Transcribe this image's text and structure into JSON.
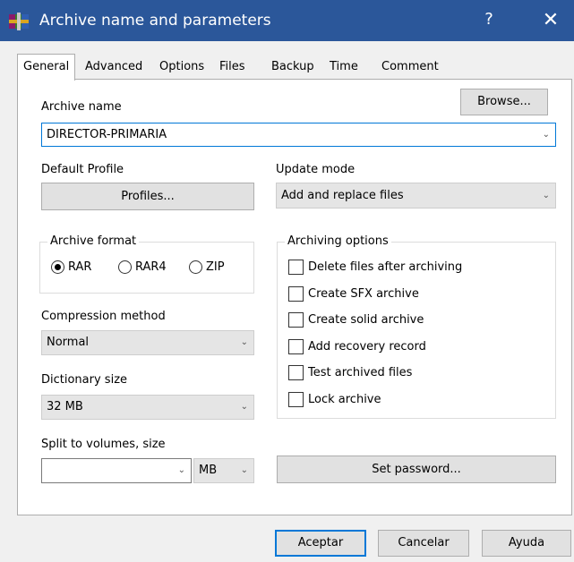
{
  "window": {
    "title": "Archive name and parameters",
    "help_glyph": "?",
    "close_glyph": "✕",
    "accent": "#2b579a"
  },
  "tabs": [
    {
      "label": "General",
      "active": true
    },
    {
      "label": "Advanced"
    },
    {
      "label": "Options"
    },
    {
      "label": "Files"
    },
    {
      "label": "Backup"
    },
    {
      "label": "Time"
    },
    {
      "label": "Comment"
    }
  ],
  "archive_name": {
    "label": "Archive name",
    "browse_label": "Browse...",
    "value": "DIRECTOR-PRIMARIA"
  },
  "default_profile": {
    "label": "Default Profile",
    "button_label": "Profiles..."
  },
  "update_mode": {
    "label": "Update mode",
    "value": "Add and replace files"
  },
  "archive_format": {
    "legend": "Archive format",
    "options": [
      {
        "label": "RAR",
        "selected": true
      },
      {
        "label": "RAR4",
        "selected": false
      },
      {
        "label": "ZIP",
        "selected": false
      }
    ]
  },
  "archiving_options": {
    "legend": "Archiving options",
    "items": [
      {
        "label": "Delete files after archiving",
        "checked": false
      },
      {
        "label": "Create SFX archive",
        "checked": false
      },
      {
        "label": "Create solid archive",
        "checked": false
      },
      {
        "label": "Add recovery record",
        "checked": false
      },
      {
        "label": "Test archived files",
        "checked": false
      },
      {
        "label": "Lock archive",
        "checked": false
      }
    ]
  },
  "compression_method": {
    "label": "Compression method",
    "value": "Normal"
  },
  "dictionary_size": {
    "label": "Dictionary size",
    "value": "32 MB"
  },
  "split_volumes": {
    "label": "Split to volumes, size",
    "value": "",
    "unit": "MB"
  },
  "set_password_label": "Set password...",
  "footer": {
    "ok_label": "Aceptar",
    "cancel_label": "Cancelar",
    "help_label": "Ayuda"
  },
  "icons": {
    "dropdown": "chevron-down-icon"
  }
}
